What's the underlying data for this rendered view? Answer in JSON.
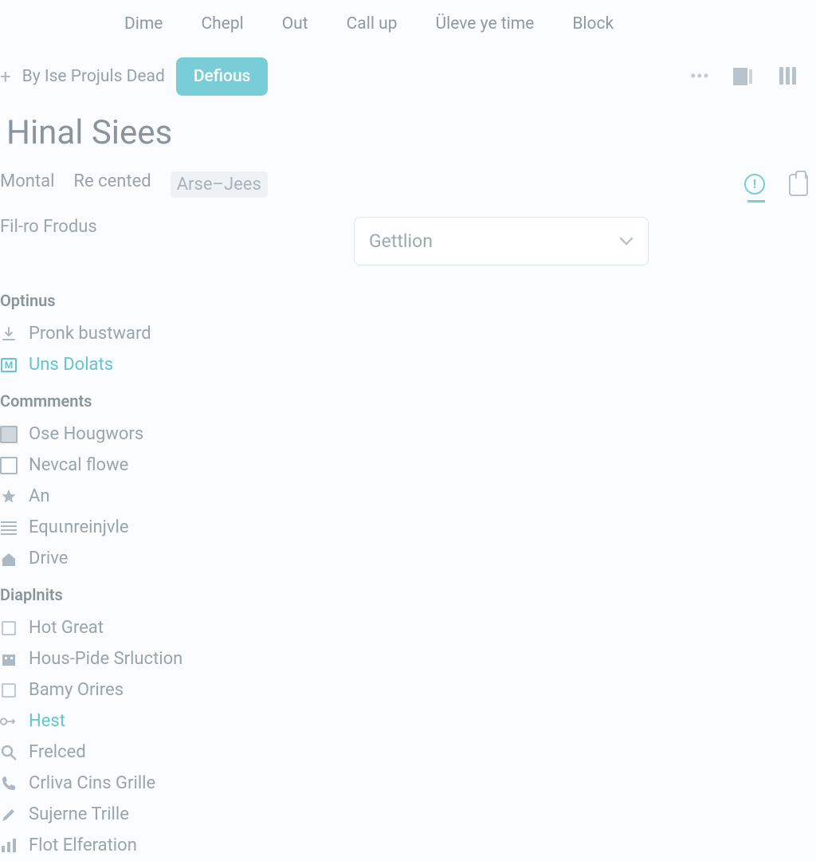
{
  "topnav": [
    "Dime",
    "Chepl",
    "Out",
    "Call up",
    "Üleve ye time",
    "Block"
  ],
  "subbar": {
    "breadcrumb": "By Ise Projuls Dead",
    "pill": "Defious"
  },
  "page_title": "Hinal Siees",
  "tabs": {
    "items": [
      "Montal",
      "Re cented",
      "Arse–Jees"
    ],
    "active_index": 2
  },
  "subtitle": "Fil-ro Frodus",
  "select": {
    "label": "Gettlion"
  },
  "sections": [
    {
      "title": "Optinus",
      "items": [
        {
          "icon": "download",
          "label": "Pronk bustward",
          "active": false
        },
        {
          "icon": "letter-m",
          "label": "Uns Dolats",
          "active": true
        }
      ]
    },
    {
      "title": "Commments",
      "items": [
        {
          "icon": "box-filled",
          "label": "Ose Hougwors",
          "active": false
        },
        {
          "icon": "box",
          "label": "Nevcal flowe",
          "active": false
        },
        {
          "icon": "star",
          "label": "An",
          "active": false
        },
        {
          "icon": "lines",
          "label": "Equιnreinjvle",
          "active": false
        },
        {
          "icon": "home",
          "label": "Drive",
          "active": false
        }
      ]
    },
    {
      "title": "Diaplnits",
      "items": [
        {
          "icon": "box-small",
          "label": "Hot Great",
          "active": false
        },
        {
          "icon": "building",
          "label": "Hous-Pide Srluction",
          "active": false
        },
        {
          "icon": "box-small",
          "label": "Bamy Orires",
          "active": false
        },
        {
          "icon": "dash-arrow",
          "label": "Hest",
          "active": true
        },
        {
          "icon": "search",
          "label": "Frelced",
          "active": false
        },
        {
          "icon": "phone",
          "label": "Crliva Cins Grille",
          "active": false
        },
        {
          "icon": "pencil",
          "label": "Sujerne Trille",
          "active": false
        },
        {
          "icon": "chart",
          "label": "Flot Elferation",
          "active": false
        }
      ]
    }
  ]
}
